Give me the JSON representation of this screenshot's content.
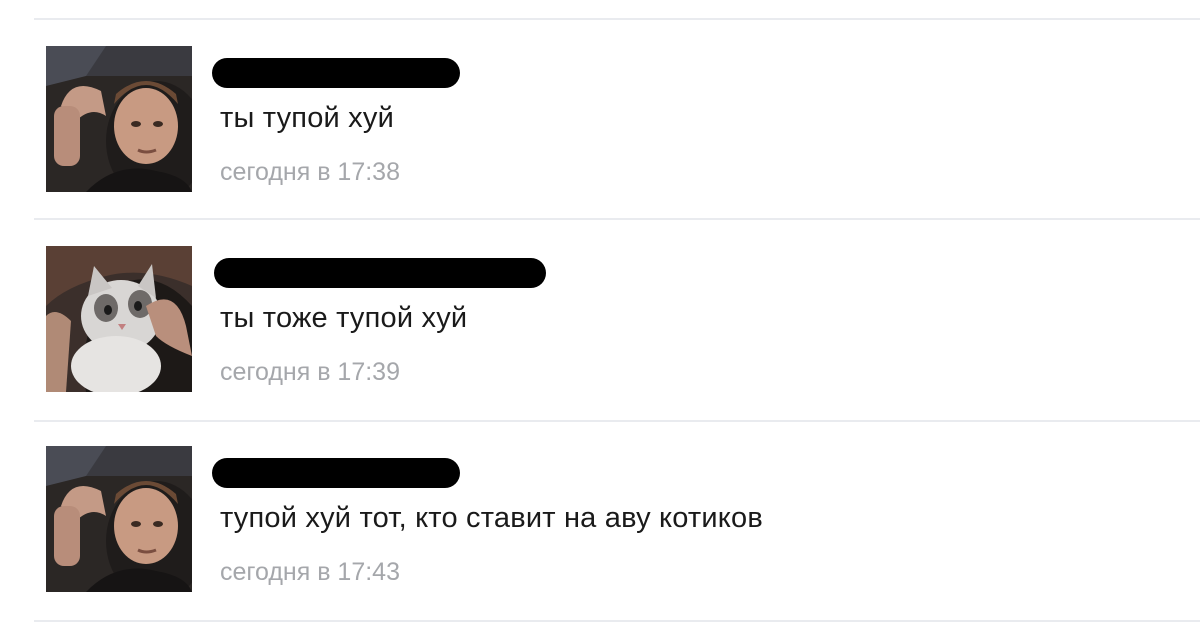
{
  "messages": [
    {
      "author": "",
      "avatar": "man-photo-avatar",
      "text": "ты тупой хуй",
      "time": "сегодня в 17:38"
    },
    {
      "author": "",
      "avatar": "cat-photo-avatar",
      "text": "ты тоже тупой хуй",
      "time": "сегодня в 17:39"
    },
    {
      "author": "",
      "avatar": "man-photo-avatar",
      "text": "тупой хуй тот, кто ставит на аву котиков",
      "time": "сегодня в 17:43"
    }
  ],
  "colors": {
    "text": "#1a1a1a",
    "timestamp": "#a5a7ab",
    "divider": "#e9ebef",
    "redaction": "#000000"
  }
}
